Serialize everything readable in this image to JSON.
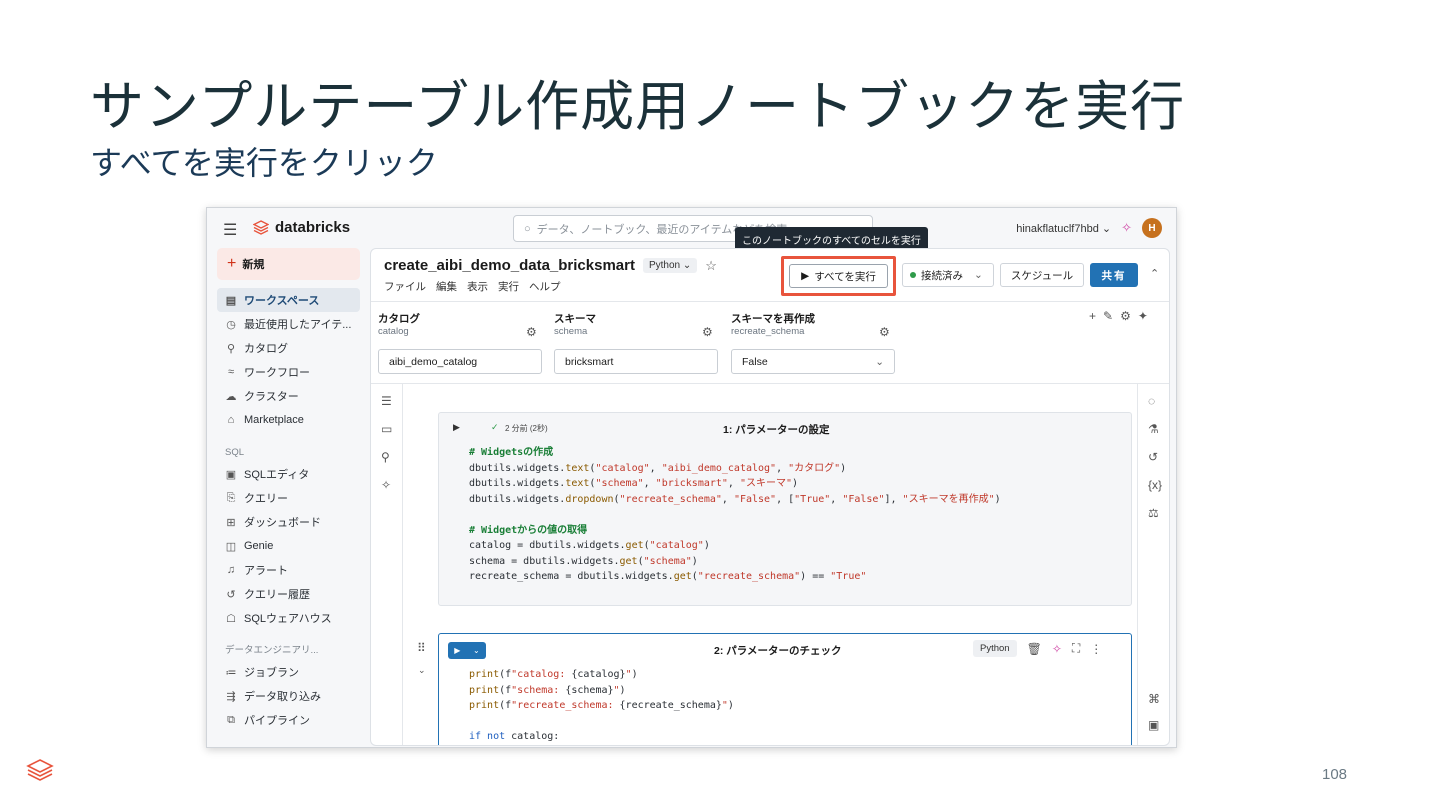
{
  "slide": {
    "title": "サンプルテーブル作成用ノートブックを実行",
    "subtitle": "すべてを実行をクリック",
    "page_number": "108"
  },
  "topbar": {
    "brand": "databricks",
    "search_placeholder": "データ、ノートブック、最近のアイテムなどを検索...",
    "user": "hinakflatuclf7hbd",
    "avatar_initial": "H",
    "tooltip": "このノートブックのすべてのセルを実行"
  },
  "sidebar": {
    "new_label": "新規",
    "items": [
      {
        "label": "ワークスペース",
        "icon": "folder-icon",
        "active": true
      },
      {
        "label": "最近使用したアイテ...",
        "icon": "clock-icon"
      },
      {
        "label": "カタログ",
        "icon": "catalog-icon"
      },
      {
        "label": "ワークフロー",
        "icon": "workflow-icon"
      },
      {
        "label": "クラスター",
        "icon": "cloud-icon"
      },
      {
        "label": "Marketplace",
        "icon": "store-icon"
      }
    ],
    "sql_section": "SQL",
    "sql_items": [
      {
        "label": "SQLエディタ",
        "icon": "editor-icon"
      },
      {
        "label": "クエリー",
        "icon": "query-icon"
      },
      {
        "label": "ダッシュボード",
        "icon": "dashboard-icon"
      },
      {
        "label": "Genie",
        "icon": "genie-icon"
      },
      {
        "label": "アラート",
        "icon": "bell-icon"
      },
      {
        "label": "クエリー履歴",
        "icon": "history-icon"
      },
      {
        "label": "SQLウェアハウス",
        "icon": "warehouse-icon"
      }
    ],
    "de_section": "データエンジニアリ...",
    "de_items": [
      {
        "label": "ジョブラン",
        "icon": "jobs-icon"
      },
      {
        "label": "データ取り込み",
        "icon": "ingest-icon"
      },
      {
        "label": "パイプライン",
        "icon": "pipeline-icon"
      }
    ]
  },
  "notebook": {
    "name": "create_aibi_demo_data_bricksmart",
    "language": "Python",
    "menu": [
      "ファイル",
      "編集",
      "表示",
      "実行",
      "ヘルプ"
    ],
    "run_all_label": "すべてを実行",
    "connected_label": "接続済み",
    "schedule_label": "スケジュール",
    "share_label": "共有"
  },
  "widgets": [
    {
      "label": "カタログ",
      "sub": "catalog",
      "value": "aibi_demo_catalog"
    },
    {
      "label": "スキーマ",
      "sub": "schema",
      "value": "bricksmart"
    },
    {
      "label": "スキーマを再作成",
      "sub": "recreate_schema",
      "value": "False"
    }
  ],
  "cell1": {
    "status": "2 分前 (2秒)",
    "title": "1: パラメーターの設定"
  },
  "cell2": {
    "title": "2: パラメーターのチェック",
    "language": "Python"
  },
  "colors": {
    "accent": "#2272b4",
    "highlight_border": "#e8543c",
    "brand": "#d0331a"
  }
}
